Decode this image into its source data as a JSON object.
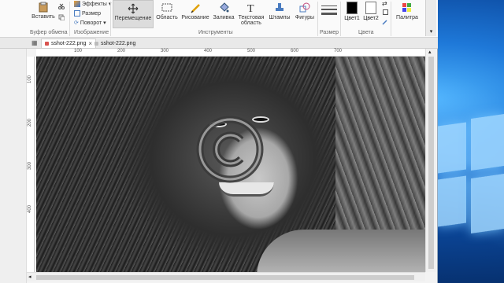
{
  "ribbon": {
    "clipboard": {
      "paste_label": "Вставить",
      "group_label": "Буфер обмена"
    },
    "image": {
      "effects_label": "Эффекты",
      "resize_label": "Размер",
      "rotate_label": "Поворот",
      "group_label": "Изображение"
    },
    "tools": {
      "move_label": "Перемещение",
      "area_label": "Область",
      "draw_label": "Рисование",
      "fill_label": "Заливка",
      "text_label_line1": "Текстовая",
      "text_label_line2": "область",
      "stamps_label": "Штампы",
      "shapes_label": "Фигуры",
      "group_label": "Инструменты"
    },
    "size": {
      "group_label": "Размер"
    },
    "colors": {
      "color1_label": "Цвет1",
      "color2_label": "Цвет2",
      "color1_value": "#000000",
      "color2_value": "#ffffff",
      "group_label": "Цвета"
    },
    "palette": {
      "label": "Палитра"
    }
  },
  "tabs": [
    {
      "label": "sshot-222.png",
      "active": true
    },
    {
      "label": "sshot-222.png",
      "active": false
    }
  ],
  "rulers": {
    "horizontal": [
      "100",
      "200",
      "300",
      "400",
      "500",
      "600",
      "700"
    ],
    "vertical": [
      "100",
      "200",
      "300",
      "400"
    ]
  },
  "canvas": {
    "image_name": "portrait-with-copyright-watermark"
  },
  "colors": {
    "accent": "#d9534f",
    "brand_blue": "#1e78d8"
  }
}
